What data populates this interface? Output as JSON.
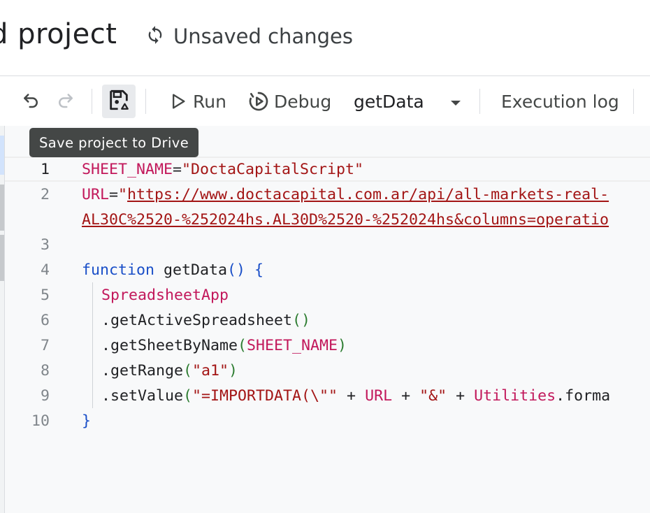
{
  "header": {
    "project_title": "d project",
    "save_status": "Unsaved changes"
  },
  "toolbar": {
    "run_label": "Run",
    "debug_label": "Debug",
    "function_select": "getData",
    "execution_log_label": "Execution log"
  },
  "tooltip": {
    "text": "Save project to Drive"
  },
  "editor": {
    "line_numbers": [
      "1",
      "2",
      "",
      "3",
      "4",
      "5",
      "6",
      "7",
      "8",
      "9",
      "10"
    ],
    "line1": {
      "var": "SHEET_NAME",
      "op": "=",
      "str": "\"DoctaCapitalScript\""
    },
    "line2": {
      "var": "URL",
      "op": "=",
      "quote": "\"",
      "url": "https://www.doctacapital.com.ar/api/all-markets-real-"
    },
    "line2_wrap": {
      "url": "AL30C%2520-%252024hs.AL30D%2520-%252024hs&columns=operatio"
    },
    "line4": {
      "kw": "function",
      "name": " getData",
      "parens": "()",
      "brace": " {"
    },
    "line5": {
      "obj": "SpreadsheetApp"
    },
    "line6": {
      "method": ".getActiveSpreadsheet",
      "parens": "()"
    },
    "line7": {
      "method": ".getSheetByName",
      "open": "(",
      "arg": "SHEET_NAME",
      "close": ")"
    },
    "line8": {
      "method": ".getRange",
      "open": "(",
      "arg": "\"a1\"",
      "close": ")"
    },
    "line9": {
      "method": ".setValue",
      "open": "(",
      "s1": "\"=IMPORTDATA(\\\"\"",
      "plus1": " + ",
      "url": "URL",
      "plus2": " + ",
      "s2": "\"&\"",
      "plus3": " + ",
      "util": "Utilities",
      "rest": ".forma"
    },
    "line10": {
      "brace": "}"
    }
  },
  "colors": {
    "variable": "#c2185b",
    "string": "#a31515",
    "keyword": "#1a4fc8",
    "editor_bg": "#f8f9fa",
    "tooltip_bg": "#444746"
  },
  "icons": [
    "sync-icon",
    "undo-icon",
    "redo-icon",
    "save-to-drive-icon",
    "play-icon",
    "debug-icon",
    "dropdown-arrow-icon"
  ]
}
